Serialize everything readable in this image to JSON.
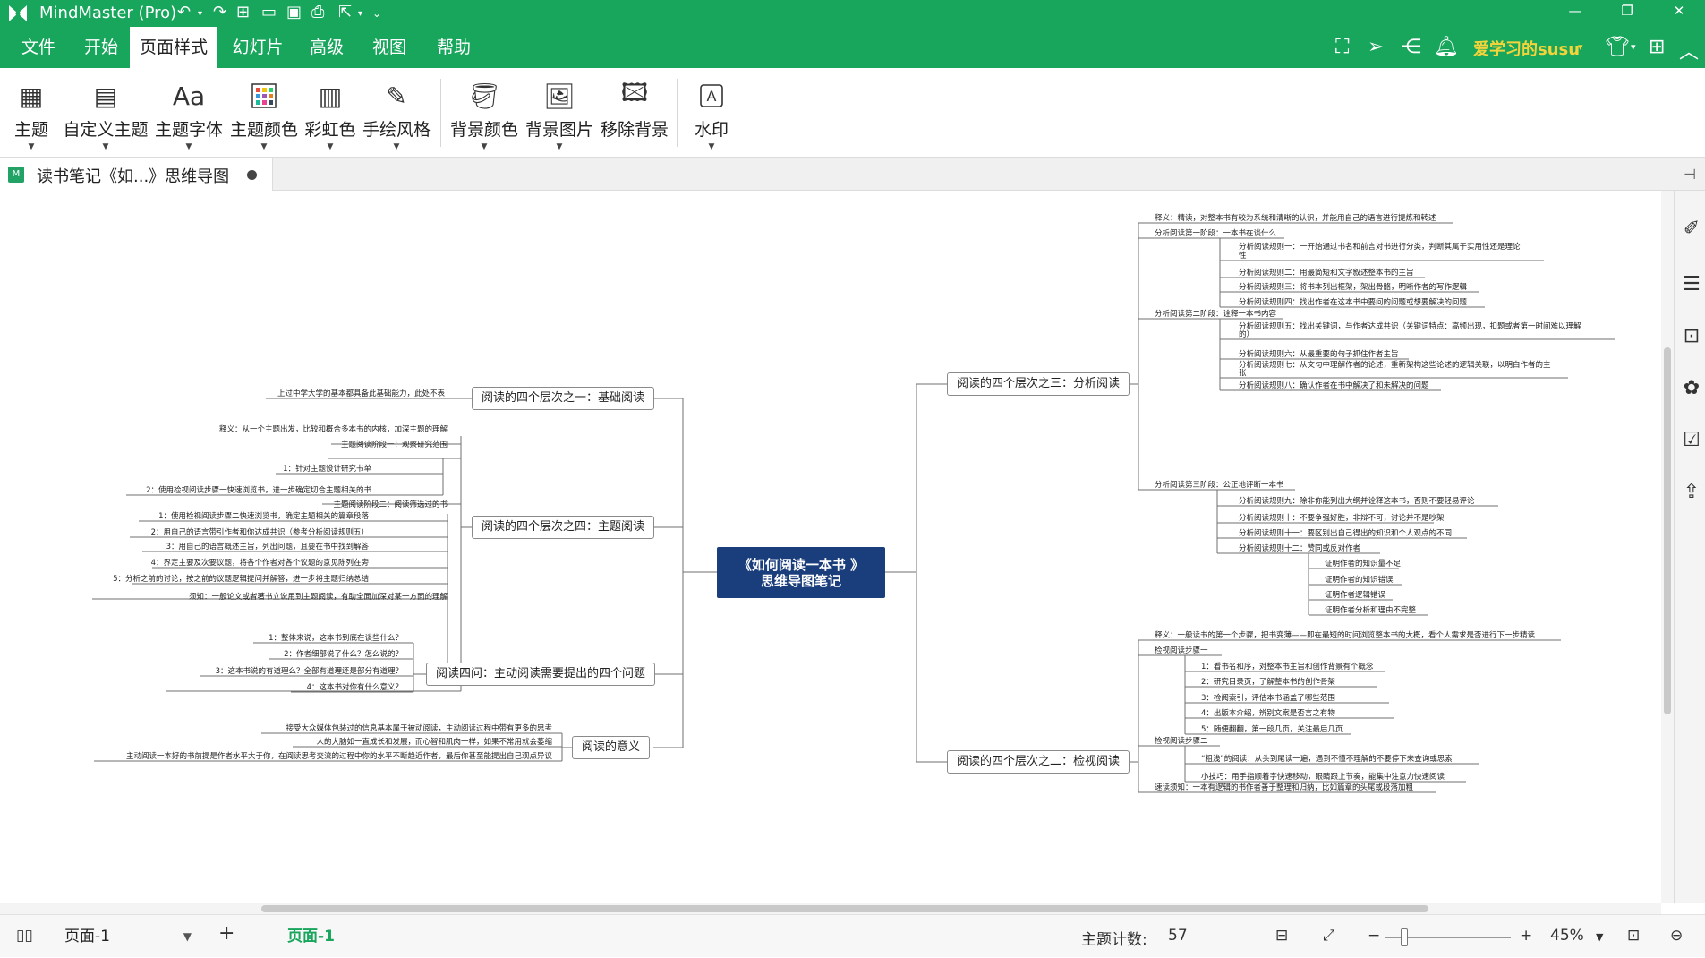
{
  "app": {
    "title": "MindMaster (Pro)"
  },
  "menu": {
    "tabs": [
      {
        "label": "文件"
      },
      {
        "label": "开始"
      },
      {
        "label": "页面样式"
      },
      {
        "label": "幻灯片"
      },
      {
        "label": "高级"
      },
      {
        "label": "视图"
      },
      {
        "label": "帮助"
      }
    ],
    "active_tab": "页面样式"
  },
  "user": {
    "name": "爱学习的susu"
  },
  "ribbon": {
    "buttons": [
      {
        "label": "主题"
      },
      {
        "label": "自定义主题"
      },
      {
        "label": "主题字体"
      },
      {
        "label": "主题颜色"
      },
      {
        "label": "彩虹色"
      },
      {
        "label": "手绘风格"
      },
      {
        "label": "背景颜色"
      },
      {
        "label": "背景图片"
      },
      {
        "label": "移除背景"
      },
      {
        "label": "水印"
      }
    ],
    "font_glyph": "Aa"
  },
  "document": {
    "tab_title": "读书笔记《如...》思维导图",
    "file_badge": "M"
  },
  "mindmap": {
    "central": {
      "line1": "《如何阅读一本书 》",
      "line2": "思维导图笔记"
    },
    "branches": [
      {
        "label": "阅读的四个层次之一：基础阅读"
      },
      {
        "label": "阅读的四个层次之四：主题阅读"
      },
      {
        "label": "阅读四问：主动阅读需要提出的四个问题"
      },
      {
        "label": "阅读的意义"
      },
      {
        "label": "阅读的四个层次之三：分析阅读"
      },
      {
        "label": "阅读的四个层次之二：检视阅读"
      }
    ],
    "left_leaves": [
      {
        "text": "上过中学大学的基本都具备此基础能力，此处不表"
      },
      {
        "text": "释义：从一个主题出发，比较和概合多本书的内核，加深主题的理解"
      },
      {
        "text": "主题阅读阶段一：观察研究范围"
      },
      {
        "text": "1：针对主题设计研究书单"
      },
      {
        "text": "2：使用检视阅读步骤一快速浏览书，进一步确定切合主题相关的书"
      },
      {
        "text": "主题阅读阶段二：阅读筛选过的书"
      },
      {
        "text": "1：使用检视阅读步骤二快速浏览书，确定主题相关的篇章段落"
      },
      {
        "text": "2：用自己的语言带引作者和你达成共识（参考分析阅读规则五）"
      },
      {
        "text": "3：用自己的语言概述主旨，列出问题，且要在书中找到解答"
      },
      {
        "text": "4：界定主要及次要议题，将各个作者对各个议题的意见陈列在旁"
      },
      {
        "text": "5：分析之前的讨论，按之前的议题逻辑提问并解答，进一步将主题归纳总结"
      },
      {
        "text": "须知：一般论文或者著书立说用到主题阅读，有助全面加深对某一方面的理解"
      },
      {
        "text": "1：整体来说，这本书到底在谈些什么？"
      },
      {
        "text": "2：作者细部说了什么？怎么说的？"
      },
      {
        "text": "3：这本书说的有道理么？全部有道理还是部分有道理？"
      },
      {
        "text": "4：这本书对你有什么意义？"
      },
      {
        "text": "接受大众媒体包装过的信息基本属于被动阅读，主动阅读过程中带有更多的思考"
      },
      {
        "text": "人的大脑如一直成长和发展，而心智和肌肉一样，如果不常用就会萎缩"
      },
      {
        "text": "主动阅读一本好的书前提是作者水平大于你，在阅读思考交流的过程中你的水平不断趋近作者，最后你甚至能提出自己观点异议"
      }
    ],
    "right_leaves": [
      {
        "text": "释义：精读，对整本书有较为系统和清晰的认识，并能用自己的语言进行提炼和转述"
      },
      {
        "text": "分析阅读第一阶段：一本书在谈什么"
      },
      {
        "text": "分析阅读规则一：一开始通过书名和前言对书进行分类，判断其属于实用性还是理论"
      },
      {
        "text": "性"
      },
      {
        "text": "分析阅读规则二：用最简短和文字叙述整本书的主旨"
      },
      {
        "text": "分析阅读规则三：将书本列出框架，架出骨骼，明晰作者的写作逻辑"
      },
      {
        "text": "分析阅读规则四：找出作者在这本书中要问的问题或想要解决的问题"
      },
      {
        "text": "分析阅读第二阶段：诠释一本书内容"
      },
      {
        "text": "分析阅读规则五：找出关键词，与作者达成共识（关键词特点：高频出现，扣题或者第一时间难以理解"
      },
      {
        "text": "的）"
      },
      {
        "text": "分析阅读规则六：从最重要的句子抓住作者主旨"
      },
      {
        "text": "分析阅读规则七：从文句中理解作者的论述，重新架构这些论述的逻辑关联，以明白作者的主"
      },
      {
        "text": "张"
      },
      {
        "text": "分析阅读规则八：确认作者在书中解决了和未解决的问题"
      },
      {
        "text": "分析阅读第三阶段：公正地评断一本书"
      },
      {
        "text": "分析阅读规则九：除非你能列出大纲并诠释这本书，否则不要轻易评论"
      },
      {
        "text": "分析阅读规则十：不要争强好胜，非辩不可，讨论并不是吵架"
      },
      {
        "text": "分析阅读规则十一：要区别出自己得出的知识和个人观点的不同"
      },
      {
        "text": "分析阅读规则十二：赞同或反对作者"
      },
      {
        "text": "证明作者的知识量不足"
      },
      {
        "text": "证明作者的知识错误"
      },
      {
        "text": "证明作者逻辑错误"
      },
      {
        "text": "证明作者分析和理由不完整"
      },
      {
        "text": "释义：一般读书的第一个步骤，把书变薄——即在最短的时间浏览整本书的大概，看个人需求是否进行下一步精读"
      },
      {
        "text": "检视阅读步骤一"
      },
      {
        "text": "1：看书名和序，对整本书主旨和创作背景有个概念"
      },
      {
        "text": "2：研究目录页，了解整本书的创作骨架"
      },
      {
        "text": "3：检阅索引，评估本书涵盖了哪些范围"
      },
      {
        "text": "4：出版本介绍，辨别文案是否言之有物"
      },
      {
        "text": "5：随便翻翻，第一段几页，关注最后几页"
      },
      {
        "text": "检视阅读步骤二"
      },
      {
        "text": "“粗浅”的阅读：从头到尾读一遍，遇到不懂不理解的不要停下来查询或思索"
      },
      {
        "text": "小技巧：用手指顺着字快速移动，眼睛跟上节奏，能集中注意力快速阅读"
      },
      {
        "text": "速读须知：一本有逻辑的书作者善于整理和归纳，比如篇章的头尾或段落加粗"
      }
    ]
  },
  "statusbar": {
    "page_select": "页面-1",
    "page_tab": "页面-1",
    "topic_count_label": "主题计数:",
    "topic_count": "57",
    "zoom": "45%"
  },
  "colors": {
    "brand_green": "#18a55c",
    "central_fill": "#1a3d7c",
    "user_name": "#f3d43a"
  }
}
